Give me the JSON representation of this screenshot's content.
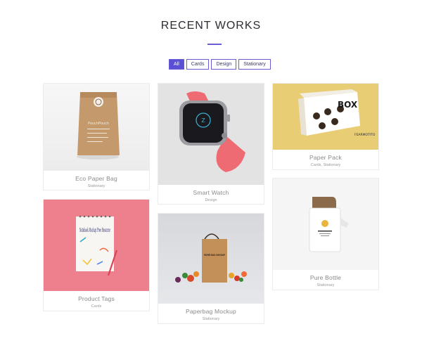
{
  "section": {
    "title": "RECENT WORKS",
    "accent_color": "#5b4fd6"
  },
  "filters": [
    {
      "label": "All",
      "active": true
    },
    {
      "label": "Cards",
      "active": false
    },
    {
      "label": "Design",
      "active": false
    },
    {
      "label": "Stationary",
      "active": false
    }
  ],
  "portfolio": [
    {
      "title": "Eco Paper Bag",
      "category": "Stationary",
      "pack_text": "PouchPouch"
    },
    {
      "title": "Smart Watch",
      "category": "Design"
    },
    {
      "title": "Paper Pack",
      "category": "Cards, Stationary",
      "box_text": "BOX",
      "brand": "FEARMOTITO"
    },
    {
      "title": "Product Tags",
      "category": "Cards",
      "notebook_text": "Notebook Mockup Free Resource"
    },
    {
      "title": "Paperbag Mockup",
      "category": "Stationary",
      "bag_text": "PAPER BAG MOCKUP"
    },
    {
      "title": "Pure Bottle",
      "category": "Stationary"
    }
  ]
}
